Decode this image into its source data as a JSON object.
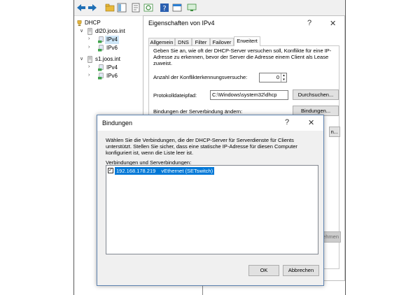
{
  "tree": {
    "root": "DHCP",
    "servers": [
      {
        "name": "dl20.joos.int",
        "children": [
          "IPv4",
          "IPv6"
        ]
      },
      {
        "name": "s1.joos.int",
        "children": [
          "IPv4",
          "IPv6"
        ]
      }
    ]
  },
  "props": {
    "title": "Eigenschaften von IPv4",
    "help": "?",
    "close": "✕",
    "tabs": [
      "Allgemein",
      "DNS",
      "Filter",
      "Failover",
      "Erweitert"
    ],
    "active_tab": "Erweitert",
    "description": "Geben Sie an, wie oft der DHCP-Server versuchen soll, Konflikte für eine IP-Adresse zu erkennen, bevor der Server die Adresse einem Client als Lease zuweist.",
    "conflict_label": "Anzahl der Konflikterkennungsversuche:",
    "conflict_value": "0",
    "log_label": "Protokolldateipfad:",
    "log_value": "C:\\Windows\\system32\\dhcp",
    "browse_button": "Durchsuchen...",
    "bindings_label": "Bindungen der Serverbindung ändern:",
    "bindings_button": "Bindungen...",
    "partial_button": "n...",
    "apply_button": "nehmen"
  },
  "bind": {
    "title": "Bindungen",
    "help": "?",
    "close": "✕",
    "description": "Wählen Sie die Verbindungen, die der DHCP-Server für Serverdienste für Clients unterstützt. Stellen Sie sicher, dass eine statische IP-Adresse für diesen Computer konfiguriert ist, wenn die Liste leer ist.",
    "list_label": "Verbindungen und Serverbindungen:",
    "rows": [
      {
        "checked": true,
        "ip": "192.168.178.219",
        "adapter": "vEthernet (SETswitch)"
      }
    ],
    "ok_button": "OK",
    "cancel_button": "Abbrechen"
  },
  "colors": {
    "selection": "#0078d7",
    "tree_selection": "#cde6f7"
  }
}
